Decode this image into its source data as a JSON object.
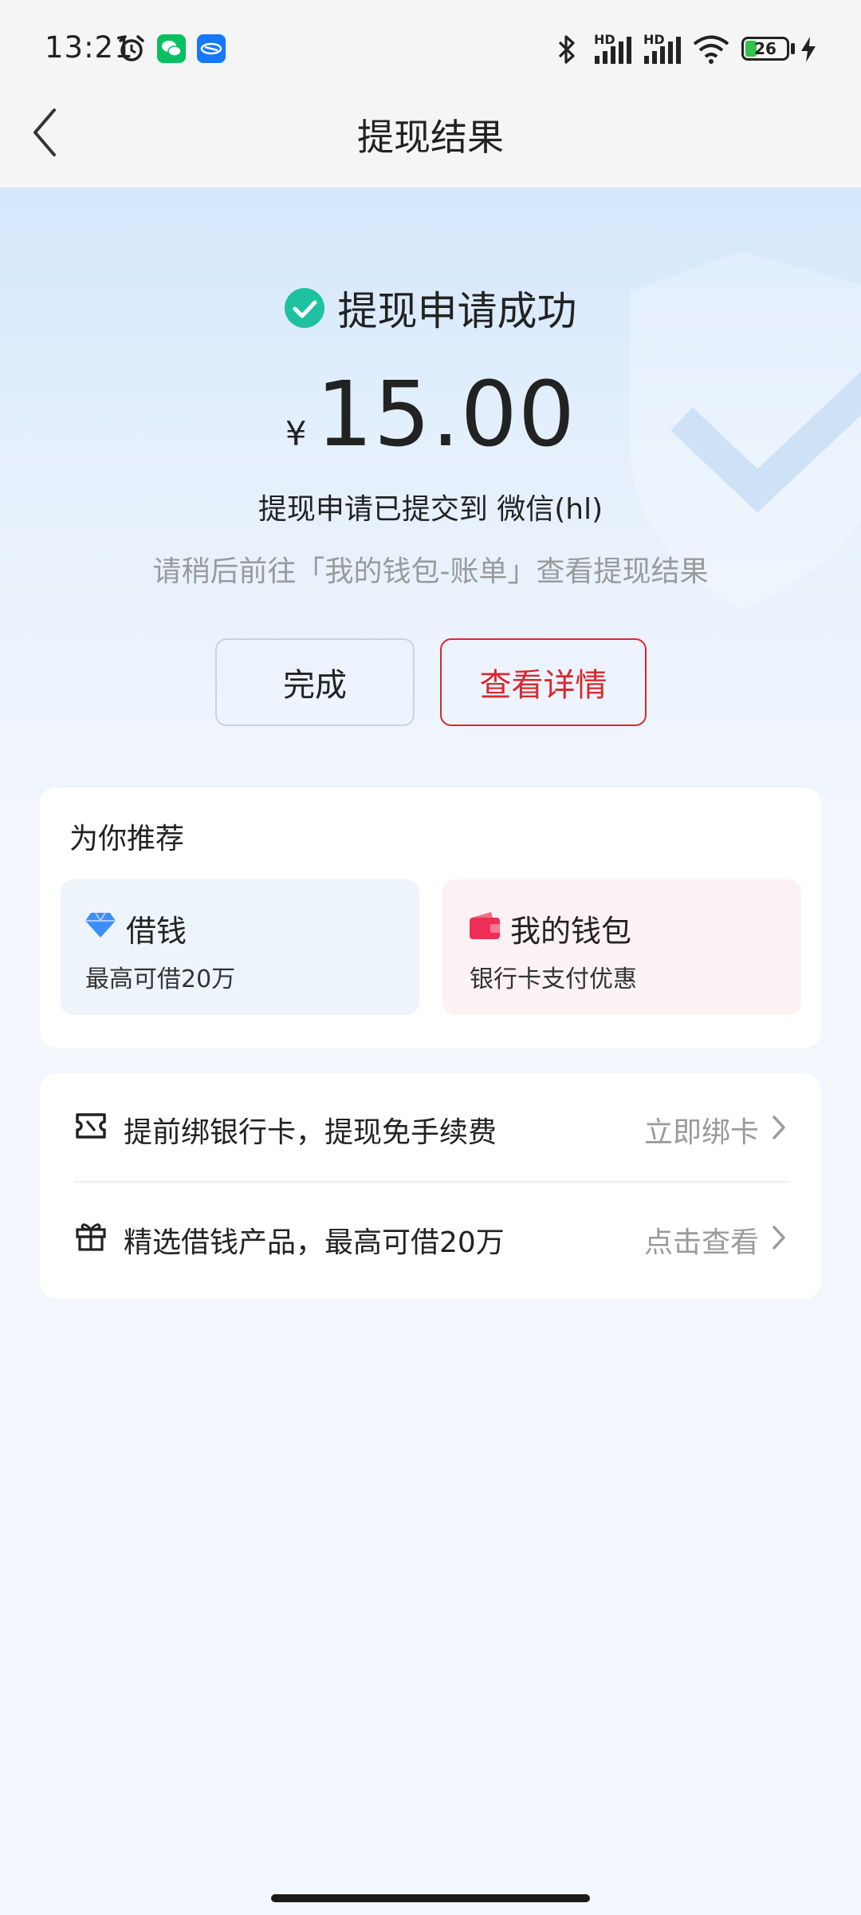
{
  "status_bar": {
    "time": "13:21",
    "hd1": "HD",
    "hd2": "HD",
    "battery": "26",
    "icons": [
      "alarm-icon",
      "wechat-icon",
      "app-icon",
      "bluetooth-icon",
      "signal-icon",
      "signal-icon",
      "wifi-icon",
      "battery-icon",
      "charging-icon"
    ]
  },
  "nav": {
    "title": "提现结果",
    "back_icon": "chevron-left-icon"
  },
  "result": {
    "title": "提现申请成功",
    "currency": "¥",
    "amount": "15.00",
    "line1": "提现申请已提交到 微信(hl)",
    "line2": "请稍后前往「我的钱包-账单」查看提现结果",
    "btn_done": "完成",
    "btn_detail": "查看详情"
  },
  "recommend": {
    "title": "为你推荐",
    "items": [
      {
        "title": "借钱",
        "subtitle": "最高可借20万",
        "icon": "diamond-icon"
      },
      {
        "title": "我的钱包",
        "subtitle": "银行卡支付优惠",
        "icon": "wallet-icon"
      }
    ]
  },
  "list": [
    {
      "text": "提前绑银行卡，提现免手续费",
      "link": "立即绑卡",
      "icon": "ticket-icon"
    },
    {
      "text": "精选借钱产品，最高可借20万",
      "link": "点击查看",
      "icon": "gift-icon"
    }
  ],
  "colors": {
    "accent_red": "#d9282f",
    "success_green": "#1ec2a1",
    "nav_bg": "#f5f5f5"
  }
}
